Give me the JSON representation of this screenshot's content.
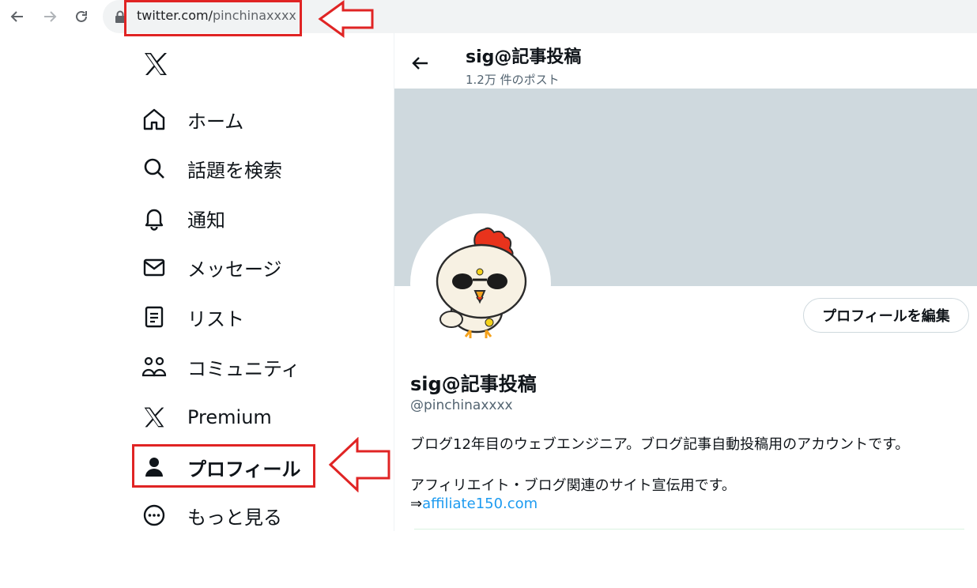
{
  "browser": {
    "url_host": "twitter.com/",
    "url_path": "pinchinaxxxx",
    "icons": [
      "back-icon",
      "forward-icon",
      "reload-icon",
      "lock-icon"
    ]
  },
  "annotation": {
    "box_color": "#e02424"
  },
  "sidebar": {
    "items": [
      {
        "label": "ホーム",
        "icon": "home-icon"
      },
      {
        "label": "話題を検索",
        "icon": "search-icon"
      },
      {
        "label": "通知",
        "icon": "bell-icon"
      },
      {
        "label": "メッセージ",
        "icon": "mail-icon"
      },
      {
        "label": "リスト",
        "icon": "list-icon"
      },
      {
        "label": "コミュニティ",
        "icon": "people-icon"
      },
      {
        "label": "Premium",
        "icon": "x-logo-icon"
      },
      {
        "label": "プロフィール",
        "icon": "person-icon"
      },
      {
        "label": "もっと見る",
        "icon": "more-circle-icon"
      }
    ]
  },
  "header": {
    "title": "sig@記事投稿",
    "post_count": "1.2万 件のポスト"
  },
  "profile": {
    "edit_button": "プロフィールを編集",
    "name": "sig@記事投稿",
    "handle": "@pinchinaxxxx",
    "bio_line1": "ブログ12年目のウェブエンジニア。ブログ記事自動投稿用のアカウントです。",
    "bio_line2": "アフィリエイト・ブログ関連のサイト宣伝用です。",
    "bio_arrow": "⇒",
    "bio_link": "affiliate150.com"
  },
  "colors": {
    "banner": "#cfd9de",
    "link": "#1d9bf0",
    "annotation": "#e02424"
  }
}
